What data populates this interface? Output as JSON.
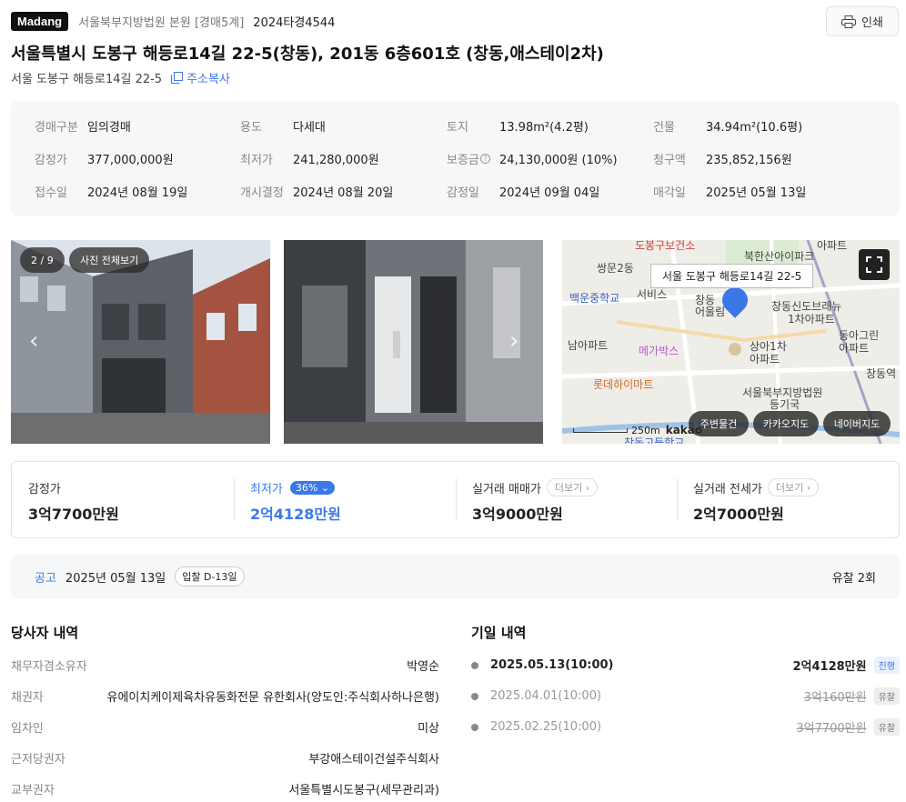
{
  "header": {
    "logo": "Madang",
    "court": "서울북부지방법원 본원 [경매5계]",
    "case_no": "2024타경4544",
    "print_label": "인쇄"
  },
  "title": "서울특별시 도봉구 해등로14길 22-5(창동), 201동 6층601호 (창동,애스테이2차)",
  "sub_address": "서울 도봉구 해등로14길 22-5",
  "copy_label": "주소복사",
  "info": [
    {
      "key": "경매구분",
      "value": "임의경매"
    },
    {
      "key": "용도",
      "value": "다세대"
    },
    {
      "key": "토지",
      "value": "13.98m²(4.2평)"
    },
    {
      "key": "건물",
      "value": "34.94m²(10.6평)"
    },
    {
      "key": "감정가",
      "value": "377,000,000원"
    },
    {
      "key": "최저가",
      "value": "241,280,000원"
    },
    {
      "key": "보증금",
      "value": "24,130,000원 (10%)"
    },
    {
      "key": "청구액",
      "value": "235,852,156원"
    },
    {
      "key": "접수일",
      "value": "2024년 08월 19일"
    },
    {
      "key": "개시결정",
      "value": "2024년 08월 20일"
    },
    {
      "key": "감정일",
      "value": "2024년 09월 04일"
    },
    {
      "key": "매각일",
      "value": "2025년 05월 13일"
    }
  ],
  "photos": {
    "counter": "2 / 9",
    "view_all": "사진 전체보기"
  },
  "map": {
    "address_tag": "서울 도봉구 해등로14길 22-5",
    "labels": [
      "도봉구보건소",
      "북한산아이파크",
      "쌍문2동",
      "아파트",
      "백운중학교",
      "서비스",
      "창동",
      "어울림",
      "창동신도브래뉴",
      "1차아파트",
      "동아그린",
      "아파트",
      "남아파트",
      "메가박스",
      "상아1차",
      "아파트",
      "롯데하이마트",
      "서울북부지방법원",
      "등기국",
      "창동역",
      "창동고등학교"
    ],
    "scale": "250m",
    "brand": "kakao",
    "buttons": [
      "주변물건",
      "카카오지도",
      "네이버지도"
    ],
    "colors": {
      "water": "#cfe0f2",
      "road": "#ffffff",
      "park": "#dcebd3",
      "pin": "#3b78e7"
    }
  },
  "prices": [
    {
      "label": "감정가",
      "value": "3억7700만원"
    },
    {
      "label": "최저가",
      "value": "2억4128만원",
      "badge": "36%"
    },
    {
      "label": "실거래 매매가",
      "value": "3억9000만원",
      "more": "더보기"
    },
    {
      "label": "실거래 전세가",
      "value": "2억7000만원",
      "more": "더보기"
    }
  ],
  "notice": {
    "label": "공고",
    "date": "2025년 05월 13일",
    "dday": "입찰 D-13일",
    "fail_count": "유찰 2회"
  },
  "parties": {
    "title": "당사자 내역",
    "rows": [
      {
        "key": "채무자겸소유자",
        "value": "박영순"
      },
      {
        "key": "채권자",
        "value": "유에이치케이제육차유동화전문 유한회사(양도인:주식회사하나은행)"
      },
      {
        "key": "임차인",
        "value": "미상"
      },
      {
        "key": "근저당권자",
        "value": "부강애스테이건설주식회사"
      },
      {
        "key": "교부권자",
        "value": "서울특별시도봉구(세무관리과)"
      }
    ]
  },
  "bids": {
    "title": "기일 내역",
    "rows": [
      {
        "date": "2025.05.13(10:00)",
        "price": "2억4128만원",
        "status": "진행"
      },
      {
        "date": "2025.04.01(10:00)",
        "price": "3억160만원",
        "status": "유찰"
      },
      {
        "date": "2025.02.25(10:00)",
        "price": "3억7700만원",
        "status": "유찰"
      }
    ]
  },
  "accent_color": "#3b78e7"
}
